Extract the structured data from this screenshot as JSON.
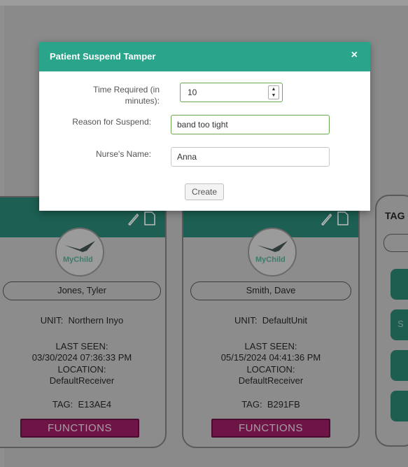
{
  "modal": {
    "title": "Patient Suspend Tamper",
    "close_glyph": "×",
    "fields": {
      "time_label": "Time Required (in minutes):",
      "time_value": "10",
      "reason_label": "Reason for Suspend:",
      "reason_value": "band too tight",
      "nurse_label": "Nurse's Name:",
      "nurse_value": "Anna"
    },
    "create_label": "Create",
    "accent_color": "#2aa58c"
  },
  "cards": [
    {
      "logo_text": "MyChild",
      "name": "Jones, Tyler",
      "unit_label": "UNIT:",
      "unit_value": "Northern Inyo",
      "last_seen_label": "LAST SEEN:",
      "last_seen_value": "03/30/2024 07:36:33 PM",
      "location_label": "LOCATION:",
      "location_value": "DefaultReceiver",
      "tag_label": "TAG:",
      "tag_value": "E13AE4",
      "functions_label": "FUNCTIONS"
    },
    {
      "logo_text": "MyChild",
      "name": "Smith, Dave",
      "unit_label": "UNIT:",
      "unit_value": "DefaultUnit",
      "last_seen_label": "LAST SEEN:",
      "last_seen_value": "05/15/2024 04:41:36 PM",
      "location_label": "LOCATION:",
      "location_value": "DefaultReceiver",
      "tag_label": "TAG:",
      "tag_value": "B291FB",
      "functions_label": "FUNCTIONS"
    }
  ],
  "right_panel": {
    "title": "TAG",
    "button_letter": "S"
  },
  "icons": [
    "pencil-icon",
    "document-icon",
    "close-icon",
    "stork-logo"
  ]
}
